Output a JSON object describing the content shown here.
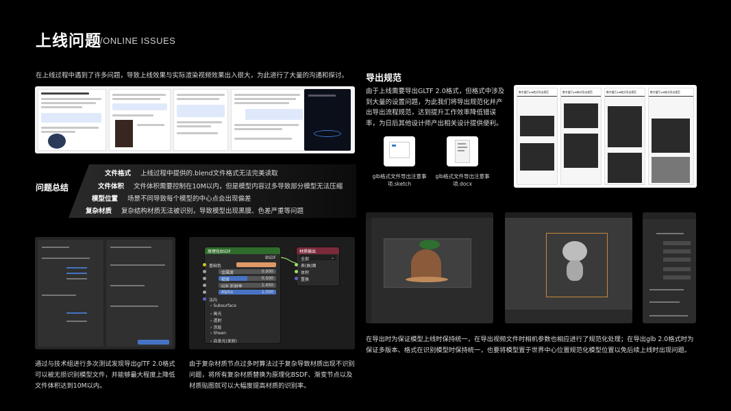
{
  "header": {
    "title": "上线问题",
    "subtitle": "/ONLINE ISSUES"
  },
  "intro": "在上线过程中遇到了许多问题，导致上线效果与实际渲染视频效果出入很大，为此进行了大量的沟通和探讨。",
  "problems": {
    "label": "问题总结",
    "items": [
      {
        "name": "文件格式",
        "desc": "上线过程中提供的.blend文件格式无法完美读取"
      },
      {
        "name": "文件体积",
        "desc": "文件体积需要控制在10M以内，但是模型内容过多导致部分模型无法压缩"
      },
      {
        "name": "模型位置",
        "desc": "场景不同导致每个模型的中心点会出现偏差"
      },
      {
        "name": "复杂材质",
        "desc": "复杂结构材质无法被识别，导致模型出现黑膜、色差严重等问题"
      }
    ]
  },
  "captions": {
    "left": "通过与技术组进行多次测试发现导出glTF 2.0格式可以被无损识别模型文件，并能够最大程度上降低文件体积达到10M以内。",
    "middle": "由于复杂材质节点过多时算法过于复杂导致材质出现不识别问题，将所有复杂材质替换为原理化BSDF、渐变节点以及材质贴图就可以大幅度提高材质的识别率。",
    "right": "在导出时为保证模型上线时保持统一，在导出视频文件时相机参数也相应进行了规范化处理；在导出glb 2.0格式时为保证多版本、格式在识别模型时保持统一，也要将模型置于世界中心位置规范化模型位置以免后续上线时出现问题。"
  },
  "export": {
    "title": "导出规范",
    "text": "由于上线需要导出GLTF 2.0格式，但格式中涉及到大量的设置问题，为此我们将导出规范化并产出导出流程规范，达到提升工作效率降低错误率，为日后其他设计师产出相关设计提供便利。",
    "files": [
      {
        "name": "glb格式文件导出注意事项.sketch"
      },
      {
        "name": "glb格式文件导出注意事项.docx"
      }
    ]
  },
  "node_editor": {
    "bsdf": {
      "title": "原理化BSDF",
      "output": "BSDF",
      "rows": [
        {
          "label": "基础色",
          "type": "color"
        },
        {
          "label": "金属度",
          "value": "0.000",
          "fill": 0
        },
        {
          "label": "糙度",
          "value": "0.500",
          "fill": 0.5
        },
        {
          "label": "IOR 折射率",
          "value": "1.450",
          "fill": 0
        },
        {
          "label": "Alpha",
          "value": "1.000",
          "fill": 1
        }
      ],
      "normal": "法向",
      "sections": [
        "Subsurface",
        "高光",
        "透射",
        "涂层",
        "Sheen",
        "自发光(发射)"
      ]
    },
    "output_node": {
      "title": "材质输出",
      "target": "全部",
      "sockets": [
        "表(曲)面",
        "体积",
        "置换"
      ]
    }
  },
  "colors": {
    "bsdf_header": "#2f6b2b",
    "output_header": "#7a2a3a",
    "accent_blue": "#4773c4",
    "base_color": "#e09a66"
  }
}
